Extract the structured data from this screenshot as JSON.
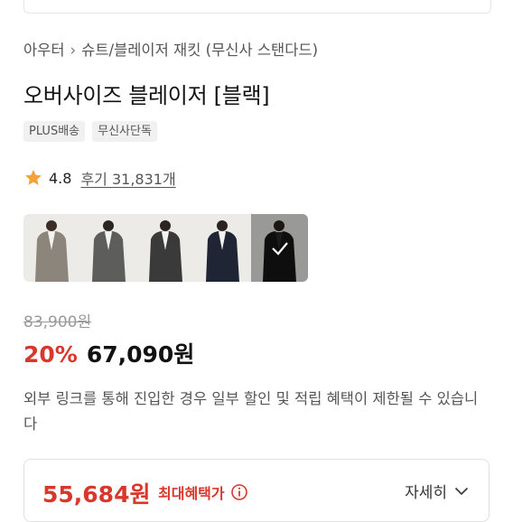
{
  "breadcrumb": {
    "items": [
      "아우터",
      "슈트/블레이저 재킷 (무신사 스탠다드)"
    ]
  },
  "product": {
    "title": "오버사이즈 블레이저 [블랙]",
    "badges": [
      "PLUS배송",
      "무신사단독"
    ],
    "rating": "4.8",
    "reviews": "후기 31,831개"
  },
  "colors": {
    "thumbnails": [
      "beige-gray",
      "charcoal",
      "dark-gray",
      "navy",
      "black"
    ],
    "selected_index": 4,
    "selected_icon": "check-icon"
  },
  "price": {
    "original": "83,900원",
    "discount": "20%",
    "sale": "67,090원"
  },
  "notice": "외부 링크를 통해 진입한 경우 일부 할인 및 적립 혜택이 제한될 수 있습니다",
  "max_benefit": {
    "price": "55,684원",
    "label": "최대혜택가",
    "detail": "자세히"
  },
  "theme": {
    "accent_red": "#d9372b",
    "star": "#f2a43a"
  }
}
